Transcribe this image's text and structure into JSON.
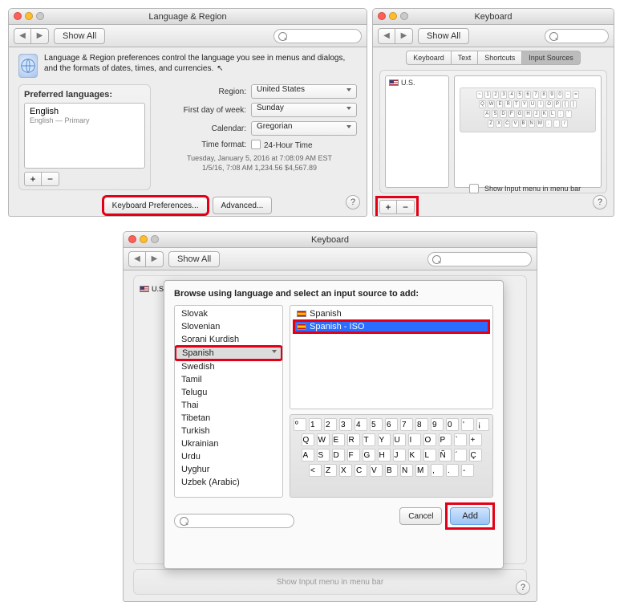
{
  "window1": {
    "title": "Language & Region",
    "show_all": "Show All",
    "intro": "Language & Region preferences control the language you see in menus and dialogs, and the formats of dates, times, and currencies.",
    "group_title": "Preferred languages:",
    "lang_primary": "English",
    "lang_primary_sub": "English — Primary",
    "region_label": "Region:",
    "region_value": "United States",
    "dow_label": "First day of week:",
    "dow_value": "Sunday",
    "cal_label": "Calendar:",
    "cal_value": "Gregorian",
    "time_label": "Time format:",
    "time_value": "24-Hour Time",
    "sample_line1": "Tuesday, January 5, 2016 at 7:08:09 AM EST",
    "sample_line2": "1/5/16, 7:08 AM   1,234.56   $4,567.89",
    "btn_kbd": "Keyboard Preferences...",
    "btn_adv": "Advanced...",
    "plus": "+",
    "minus": "−"
  },
  "window2": {
    "title": "Keyboard",
    "show_all": "Show All",
    "tabs": [
      "Keyboard",
      "Text",
      "Shortcuts",
      "Input Sources"
    ],
    "src_us": "U.S.",
    "show_menu": "Show Input menu in menu bar",
    "plus": "+",
    "minus": "−",
    "keys_row1": [
      "~",
      "1",
      "2",
      "3",
      "4",
      "5",
      "6",
      "7",
      "8",
      "9",
      "0",
      "-",
      "="
    ],
    "keys_row2": [
      "Q",
      "W",
      "E",
      "R",
      "T",
      "Y",
      "U",
      "I",
      "O",
      "P",
      "[",
      "]"
    ],
    "keys_row3": [
      "A",
      "S",
      "D",
      "F",
      "G",
      "H",
      "J",
      "K",
      "L",
      ";",
      "'"
    ],
    "keys_row4": [
      "Z",
      "X",
      "C",
      "V",
      "B",
      "N",
      "M",
      ",",
      ".",
      "/"
    ]
  },
  "window3": {
    "title": "Keyboard",
    "show_all": "Show All",
    "prompt": "Browse using language and select an input source to add:",
    "left_list": [
      "Slovak",
      "Slovenian",
      "Sorani Kurdish",
      "Spanish",
      "Swedish",
      "Tamil",
      "Telugu",
      "Thai",
      "Tibetan",
      "Turkish",
      "Ukrainian",
      "Urdu",
      "Uyghur",
      "Uzbek (Arabic)"
    ],
    "right_list": [
      {
        "label": "Spanish",
        "selected": false
      },
      {
        "label": "Spanish - ISO",
        "selected": true
      }
    ],
    "btn_cancel": "Cancel",
    "btn_add": "Add",
    "behind_src": "U.S.",
    "bottom_text": "Show Input menu in menu bar",
    "keys_row1": [
      "º",
      "1",
      "2",
      "3",
      "4",
      "5",
      "6",
      "7",
      "8",
      "9",
      "0",
      "'",
      "¡"
    ],
    "keys_row2": [
      "Q",
      "W",
      "E",
      "R",
      "T",
      "Y",
      "U",
      "I",
      "O",
      "P",
      "`",
      "+"
    ],
    "keys_row3": [
      "A",
      "S",
      "D",
      "F",
      "G",
      "H",
      "J",
      "K",
      "L",
      "Ñ",
      "´",
      "Ç"
    ],
    "keys_row4": [
      "<",
      "Z",
      "X",
      "C",
      "V",
      "B",
      "N",
      "M",
      ",",
      ".",
      "-"
    ]
  },
  "help_label": "?"
}
